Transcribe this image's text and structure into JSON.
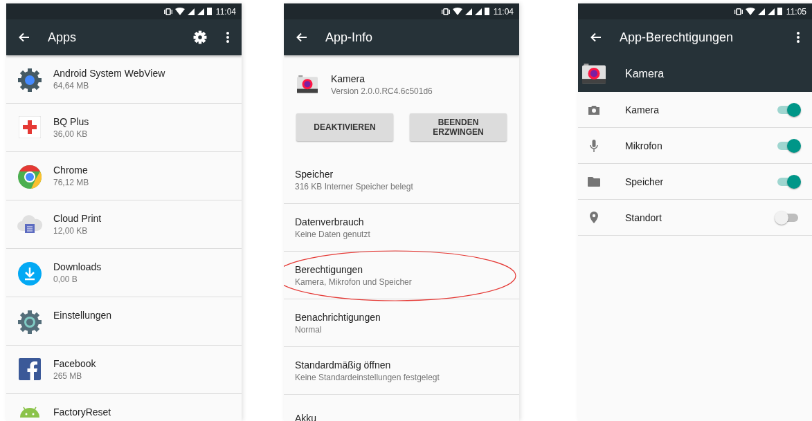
{
  "apps_screen": {
    "status_time": "11:04",
    "title": "Apps",
    "apps": [
      {
        "kind": "webview",
        "name": "Android System WebView",
        "size": "64,64 MB"
      },
      {
        "kind": "bqplus",
        "name": "BQ Plus",
        "size": "36,00 KB"
      },
      {
        "kind": "chrome",
        "name": "Chrome",
        "size": "76,12 MB"
      },
      {
        "kind": "cloudprint",
        "name": "Cloud Print",
        "size": "12,00 KB"
      },
      {
        "kind": "downloads",
        "name": "Downloads",
        "size": "0,00 B"
      },
      {
        "kind": "settings",
        "name": "Einstellungen"
      },
      {
        "kind": "facebook",
        "name": "Facebook",
        "size": "265 MB"
      },
      {
        "kind": "android",
        "name": "FactoryReset"
      }
    ]
  },
  "app_info_screen": {
    "status_time": "11:04",
    "title": "App-Info",
    "app_name": "Kamera",
    "version": "Version 2.0.0.RC4.6c501d6",
    "buttons": [
      "DEAKTIVIEREN",
      "BEENDEN\nERZWINGEN"
    ],
    "entries": [
      {
        "title": "Speicher",
        "detail": "316 KB Interner Speicher belegt",
        "circled": false
      },
      {
        "title": "Datenverbrauch",
        "detail": "Keine Daten genutzt",
        "circled": false
      },
      {
        "title": "Berechtigungen",
        "detail": "Kamera, Mikrofon und Speicher",
        "circled": true
      },
      {
        "title": "Benachrichtigungen",
        "detail": "Normal",
        "circled": false
      },
      {
        "title": "Standardmäßig öffnen",
        "detail": "Keine Standardeinstellungen festgelegt",
        "circled": false
      },
      {
        "title": "Akku",
        "circled": false
      }
    ]
  },
  "permissions_screen": {
    "status_time": "11:05",
    "title": "App-Berechtigungen",
    "app_name": "Kamera",
    "permissions": [
      {
        "kind": "camera",
        "label": "Kamera",
        "on": true
      },
      {
        "kind": "mic",
        "label": "Mikrofon",
        "on": true
      },
      {
        "kind": "folder",
        "label": "Speicher",
        "on": true
      },
      {
        "kind": "location",
        "label": "Standort",
        "on": false
      }
    ]
  }
}
